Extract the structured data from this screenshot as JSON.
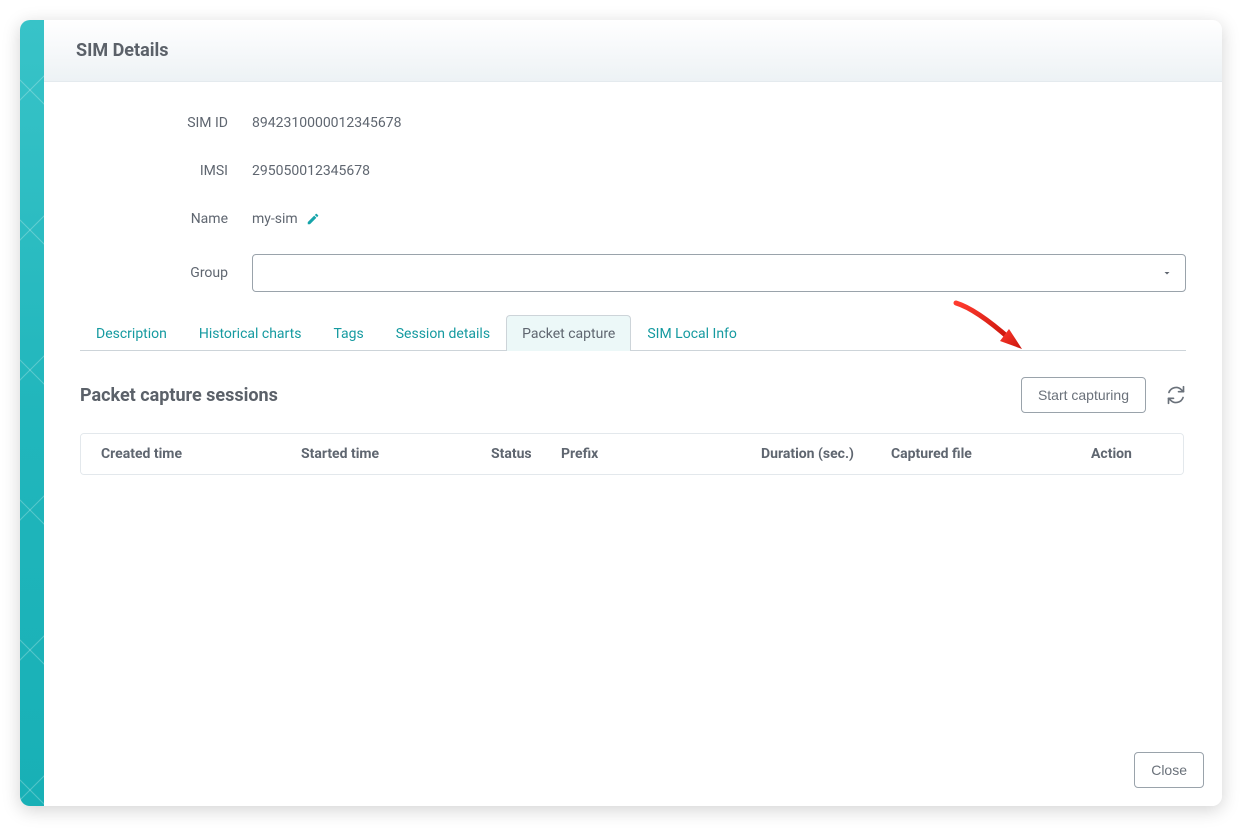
{
  "header": {
    "title": "SIM Details"
  },
  "fields": {
    "sim_id": {
      "label": "SIM ID",
      "value": "8942310000012345678"
    },
    "imsi": {
      "label": "IMSI",
      "value": "295050012345678"
    },
    "name": {
      "label": "Name",
      "value": "my-sim"
    },
    "group": {
      "label": "Group",
      "value": ""
    }
  },
  "tabs": {
    "description": "Description",
    "historical_charts": "Historical charts",
    "tags": "Tags",
    "session_details": "Session details",
    "packet_capture": "Packet capture",
    "sim_local_info": "SIM Local Info"
  },
  "section": {
    "title": "Packet capture sessions"
  },
  "actions": {
    "start_capturing": "Start capturing",
    "close": "Close"
  },
  "table": {
    "headers": {
      "created_time": "Created time",
      "started_time": "Started time",
      "status": "Status",
      "prefix": "Prefix",
      "duration": "Duration (sec.)",
      "captured_file": "Captured file",
      "action": "Action"
    },
    "rows": []
  }
}
